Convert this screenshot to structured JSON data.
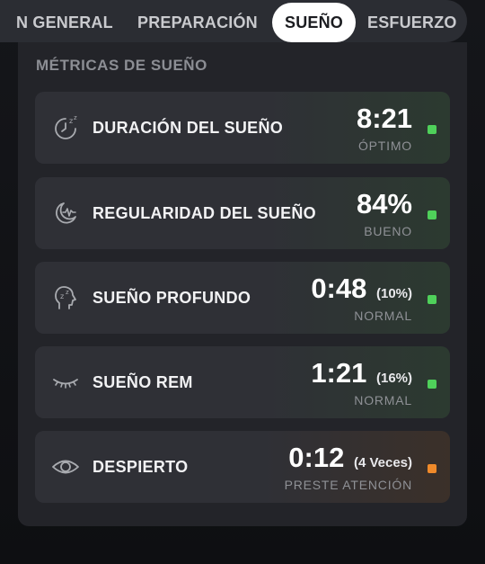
{
  "tabs": [
    {
      "label": "N GENERAL",
      "active": false
    },
    {
      "label": "PREPARACIÓN",
      "active": false
    },
    {
      "label": "SUEÑO",
      "active": true
    },
    {
      "label": "ESFUERZO",
      "active": false
    }
  ],
  "section_title": "MÉTRICAS DE SUEÑO",
  "colors": {
    "status_green": "#4fd05a",
    "status_orange": "#f08a2a"
  },
  "metrics": [
    {
      "icon": "sleep-clock-icon",
      "label": "DURACIÓN DEL SUEÑO",
      "value": "8:21",
      "extra": "",
      "status": "ÓPTIMO",
      "status_color": "green"
    },
    {
      "icon": "moon-heartbeat-icon",
      "label": "REGULARIDAD DEL SUEÑO",
      "value": "84%",
      "extra": "",
      "status": "BUENO",
      "status_color": "green"
    },
    {
      "icon": "head-zz-icon",
      "label": "SUEÑO PROFUNDO",
      "value": "0:48",
      "extra": "(10%)",
      "status": "NORMAL",
      "status_color": "green"
    },
    {
      "icon": "closed-eye-icon",
      "label": "SUEÑO REM",
      "value": "1:21",
      "extra": "(16%)",
      "status": "NORMAL",
      "status_color": "green"
    },
    {
      "icon": "eye-icon",
      "label": "DESPIERTO",
      "value": "0:12",
      "extra": "(4 Veces)",
      "status": "PRESTE ATENCIÓN",
      "status_color": "orange"
    }
  ]
}
